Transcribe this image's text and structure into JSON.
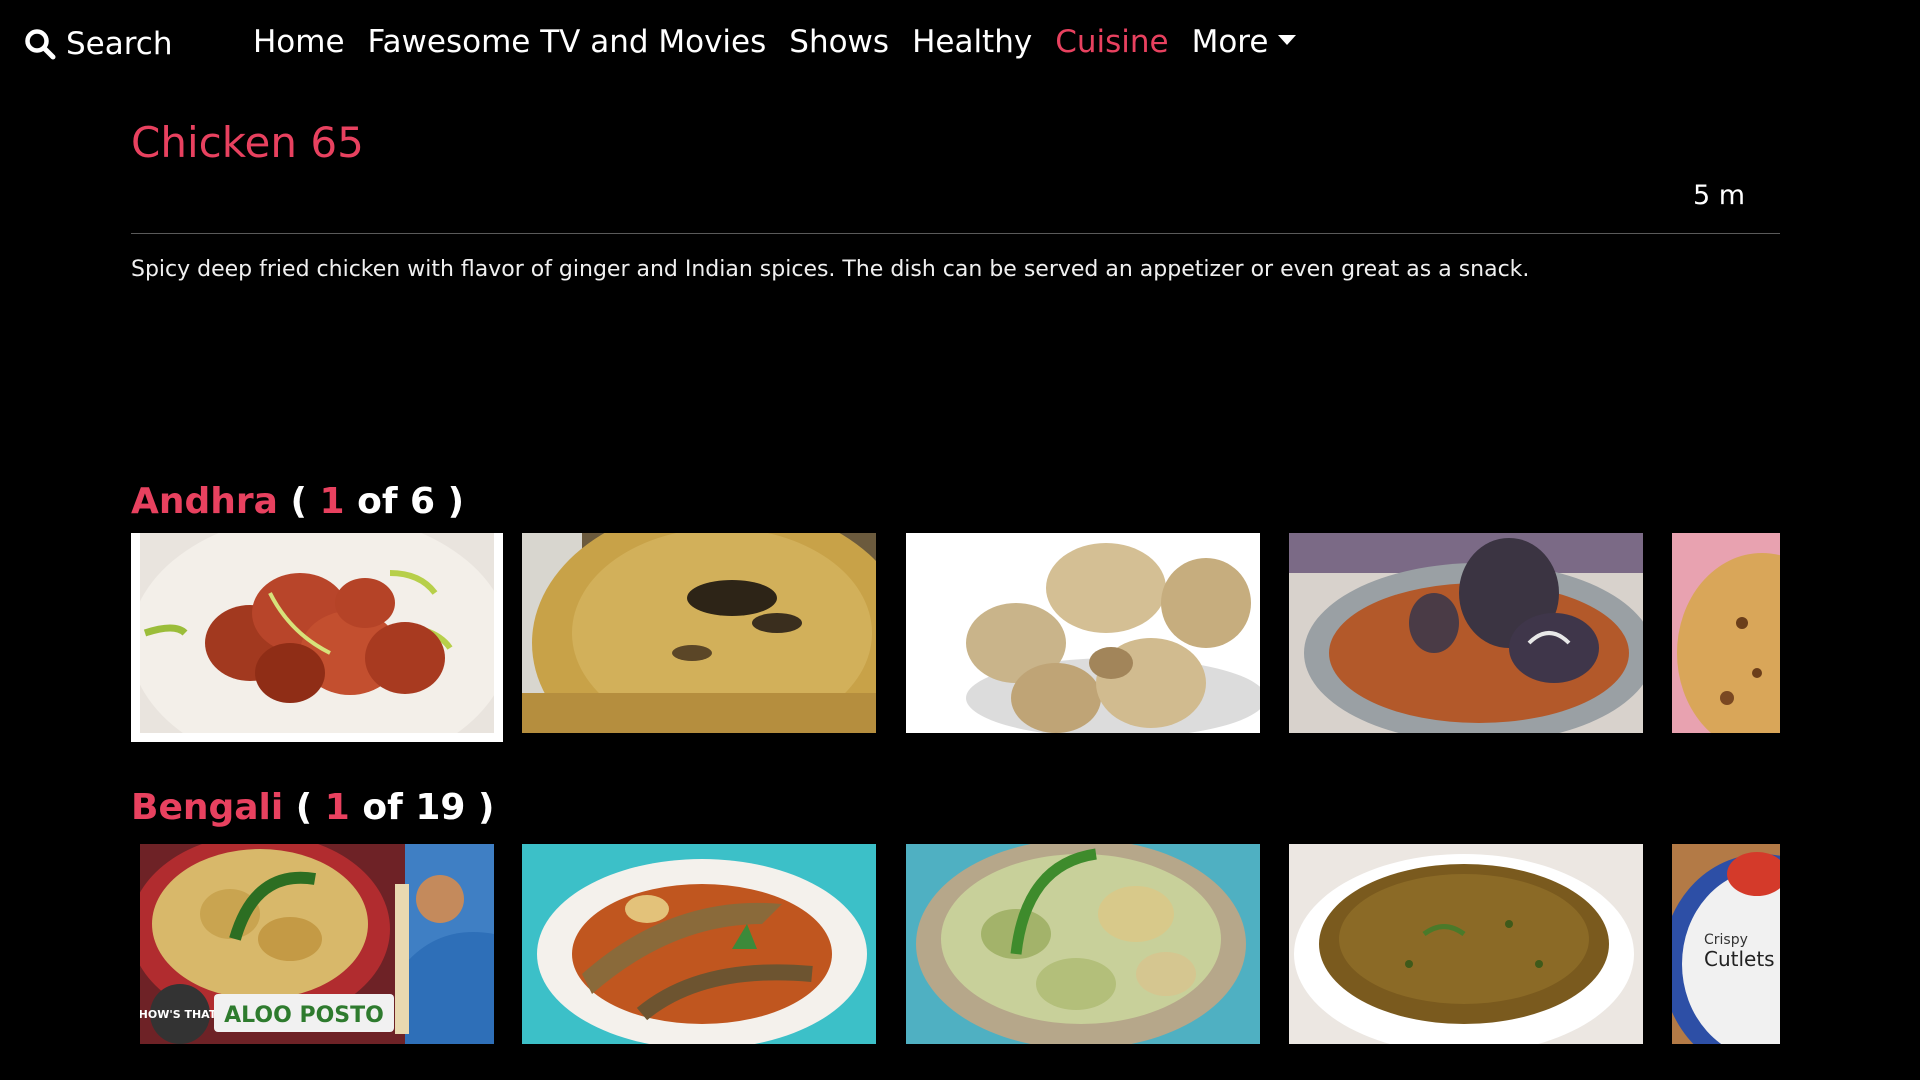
{
  "nav": {
    "search_label": "Search",
    "links": [
      "Home",
      "Fawesome TV and Movies",
      "Shows",
      "Healthy",
      "Cuisine",
      "More"
    ],
    "active": "Cuisine"
  },
  "recipe": {
    "title": "Chicken 65",
    "duration": "5 m",
    "description": "Spicy deep fried chicken with flavor of ginger and Indian spices. The dish can be served an appetizer or even great as a snack."
  },
  "rows": [
    {
      "category": "Andhra",
      "open_paren": "(",
      "index": "1",
      "of_total": "of 6",
      "close_paren": ")"
    },
    {
      "category": "Bengali",
      "open_paren": "(",
      "index": "1",
      "of_total": "of 19",
      "close_paren": ")",
      "thumb_texts": [
        "HOW'S THAT!",
        "ALOO POSTO",
        "Crispy",
        "Cutlets"
      ]
    }
  ],
  "colors": {
    "accent": "#e8415f",
    "background": "#000000",
    "text": "#ffffff"
  }
}
